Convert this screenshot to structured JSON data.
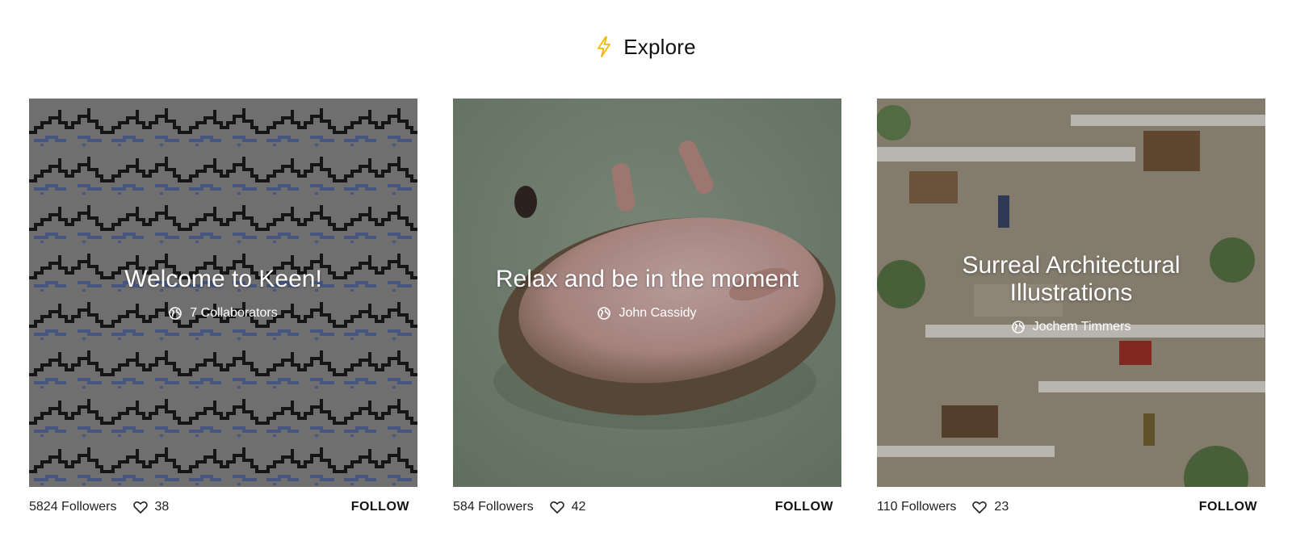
{
  "header": {
    "icon": "lightning-bolt-icon",
    "title": "Explore",
    "accent": "#f5b700"
  },
  "cards": [
    {
      "title": "Welcome to Keen!",
      "meta_icon": "globe-icon",
      "meta": "7 Collaborators",
      "followers": "5824 Followers",
      "likes_icon": "heart-icon",
      "likes": "38",
      "follow_label": "FOLLOW",
      "image": "pixel-wave-pattern"
    },
    {
      "title": "Relax and be in the moment",
      "meta_icon": "globe-icon",
      "meta": "John Cassidy",
      "followers": "584 Followers",
      "likes_icon": "heart-icon",
      "likes": "42",
      "follow_label": "FOLLOW",
      "image": "hedgehog-photo"
    },
    {
      "title": "Surreal Architectural Illustrations",
      "meta_icon": "globe-icon",
      "meta": "Jochem Timmers",
      "followers": "110 Followers",
      "likes_icon": "heart-icon",
      "likes": "23",
      "follow_label": "FOLLOW",
      "image": "architectural-illustration"
    }
  ]
}
